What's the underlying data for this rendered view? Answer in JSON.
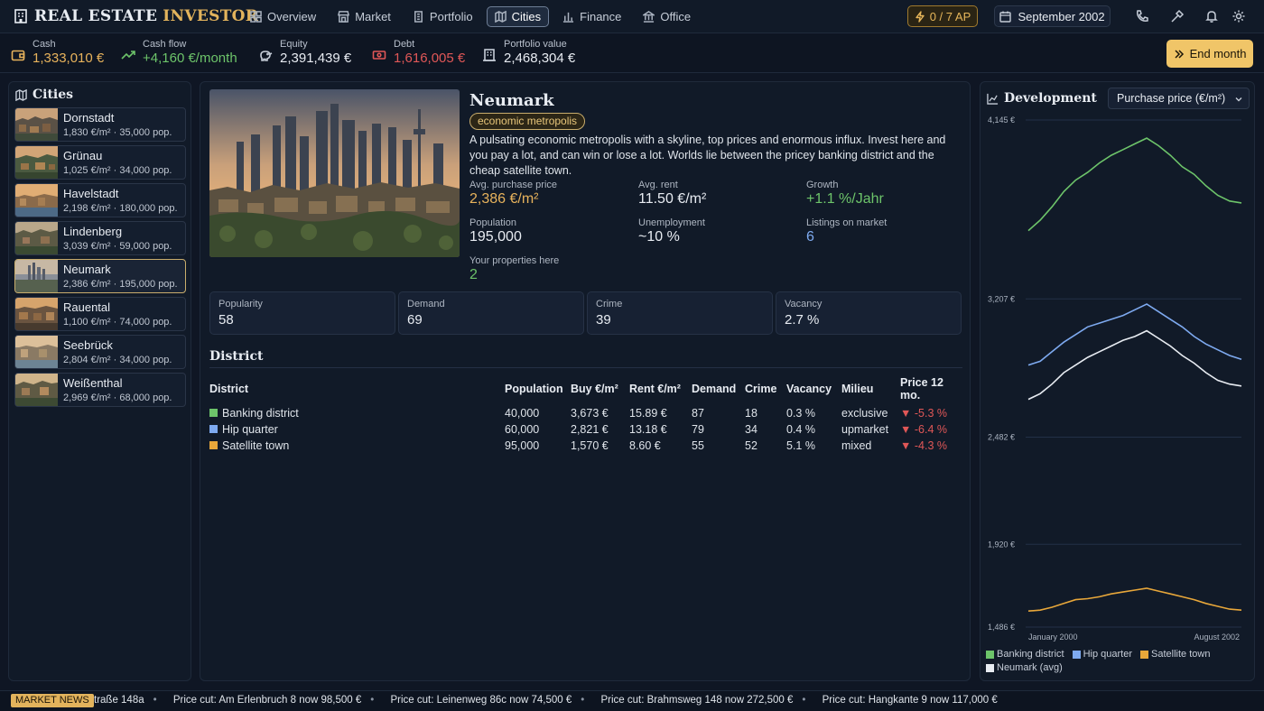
{
  "app": {
    "title_a": "REAL ESTATE",
    "title_b": "INVESTOR"
  },
  "nav": [
    {
      "label": "Overview",
      "icon": "grid-icon"
    },
    {
      "label": "Market",
      "icon": "store-icon"
    },
    {
      "label": "Portfolio",
      "icon": "building-icon"
    },
    {
      "label": "Cities",
      "icon": "map-icon",
      "active": true
    },
    {
      "label": "Finance",
      "icon": "chart-bar-icon"
    },
    {
      "label": "Office",
      "icon": "bank-icon"
    }
  ],
  "topbar": {
    "ap": "0 / 7 AP",
    "date": "September 2002"
  },
  "stats": [
    {
      "label": "Cash",
      "value": "1,333,010 €",
      "color": "#e8b35c",
      "icon": "wallet-icon"
    },
    {
      "label": "Cash flow",
      "value": "+4,160 €/month",
      "color": "#6dc46a",
      "icon": "trend-up-icon"
    },
    {
      "label": "Equity",
      "value": "2,391,439 €",
      "color": "#e8ecf2",
      "icon": "piggy-bank-icon"
    },
    {
      "label": "Debt",
      "value": "1,616,005 €",
      "color": "#e05757",
      "icon": "banknote-icon"
    },
    {
      "label": "Portfolio value",
      "value": "2,468,304 €",
      "color": "#e8ecf2",
      "icon": "office-building-icon"
    }
  ],
  "end_month": "End month",
  "cities_panel": {
    "title": "Cities"
  },
  "cities": [
    {
      "name": "Dornstadt",
      "price": "1,830 €/m²",
      "pop": "35,000 pop."
    },
    {
      "name": "Grünau",
      "price": "1,025 €/m²",
      "pop": "34,000 pop."
    },
    {
      "name": "Havelstadt",
      "price": "2,198 €/m²",
      "pop": "180,000 pop."
    },
    {
      "name": "Lindenberg",
      "price": "3,039 €/m²",
      "pop": "59,000 pop."
    },
    {
      "name": "Neumark",
      "price": "2,386 €/m²",
      "pop": "195,000 pop.",
      "active": true
    },
    {
      "name": "Rauental",
      "price": "1,100 €/m²",
      "pop": "74,000 pop."
    },
    {
      "name": "Seebrück",
      "price": "2,804 €/m²",
      "pop": "34,000 pop."
    },
    {
      "name": "Weißenthal",
      "price": "2,969 €/m²",
      "pop": "68,000 pop."
    }
  ],
  "city_detail": {
    "name": "Neumark",
    "tag": "economic metropolis",
    "description": "A pulsating economic metropolis with a skyline, top prices and enormous influx. Invest here and you pay a lot, and can win or lose a lot. Worlds lie between the pricey banking district and the cheap satellite town.",
    "kv": [
      {
        "label": "Avg. purchase price",
        "value": "2,386 €/m²",
        "color": "#e8b35c"
      },
      {
        "label": "Avg. rent",
        "value": "11.50 €/m²",
        "color": "#e8ecf2"
      },
      {
        "label": "Growth",
        "value": "+1.1 %/Jahr",
        "color": "#6dc46a"
      },
      {
        "label": "Population",
        "value": "195,000",
        "color": "#e8ecf2"
      },
      {
        "label": "Unemployment",
        "value": "~10 %",
        "color": "#e8ecf2"
      },
      {
        "label": "Listings on market",
        "value": "6",
        "color": "#7eaaf0"
      },
      {
        "label": "Your properties here",
        "value": "2",
        "color": "#6dc46a"
      }
    ],
    "cards": [
      {
        "label": "Popularity",
        "value": "58"
      },
      {
        "label": "Demand",
        "value": "69"
      },
      {
        "label": "Crime",
        "value": "39"
      },
      {
        "label": "Vacancy",
        "value": "2.7 %"
      }
    ],
    "district_title": "District"
  },
  "district_table": {
    "headers": [
      "District",
      "Population",
      "Buy €/m²",
      "Rent €/m²",
      "Demand",
      "Crime",
      "Vacancy",
      "Milieu",
      "Price 12 mo."
    ],
    "rows": [
      {
        "color": "#6dc46a",
        "cells": [
          "Banking district",
          "40,000",
          "3,673 €",
          "15.89 €",
          "87",
          "18",
          "0.3 %",
          "exclusive",
          "-5.3 %"
        ]
      },
      {
        "color": "#7eaaf0",
        "cells": [
          "Hip quarter",
          "60,000",
          "2,821 €",
          "13.18 €",
          "79",
          "34",
          "0.4 %",
          "upmarket",
          "-6.4 %"
        ]
      },
      {
        "color": "#e8a73a",
        "cells": [
          "Satellite town",
          "95,000",
          "1,570 €",
          "8.60 €",
          "55",
          "52",
          "5.1 %",
          "mixed",
          "-4.3 %"
        ]
      }
    ]
  },
  "development": {
    "title": "Development",
    "select": "Purchase price (€/m²)"
  },
  "chart_data": {
    "type": "line",
    "ylim": [
      1486,
      4145
    ],
    "yticks": [
      "4,145 €",
      "3,207 €",
      "2,482 €",
      "1,920 €",
      "1,486 €"
    ],
    "ytick_values": [
      4145,
      3207,
      2482,
      1920,
      1486
    ],
    "xlabels": [
      "January 2000",
      "August 2002"
    ],
    "series": [
      {
        "name": "Banking district",
        "color": "#6dc46a",
        "values": [
          3565,
          3620,
          3690,
          3770,
          3830,
          3870,
          3920,
          3960,
          3990,
          4020,
          4050,
          4010,
          3960,
          3900,
          3860,
          3800,
          3750,
          3720,
          3710
        ]
      },
      {
        "name": "Hip quarter",
        "color": "#7eaaf0",
        "values": [
          2860,
          2880,
          2930,
          2980,
          3020,
          3060,
          3080,
          3100,
          3120,
          3150,
          3180,
          3140,
          3100,
          3060,
          3010,
          2970,
          2940,
          2910,
          2890
        ]
      },
      {
        "name": "Satellite town",
        "color": "#e8a73a",
        "values": [
          1570,
          1575,
          1590,
          1610,
          1630,
          1635,
          1645,
          1660,
          1670,
          1680,
          1690,
          1675,
          1660,
          1645,
          1630,
          1610,
          1595,
          1580,
          1575
        ]
      },
      {
        "name": "Neumark (avg)",
        "color": "#e8ecf2",
        "values": [
          2680,
          2710,
          2760,
          2820,
          2860,
          2900,
          2930,
          2960,
          2990,
          3010,
          3040,
          3000,
          2960,
          2910,
          2870,
          2820,
          2780,
          2760,
          2750
        ]
      }
    ]
  },
  "ticker": {
    "badge": "MARKET NEWS",
    "items": [
      "traße 148a",
      "Price cut: Am Erlenbruch 8 now 98,500 €",
      "Price cut: Leinenweg 86c now 74,500 €",
      "Price cut: Brahmsweg 148 now 272,500 €",
      "Price cut: Hangkante 9 now 117,000 €"
    ]
  }
}
